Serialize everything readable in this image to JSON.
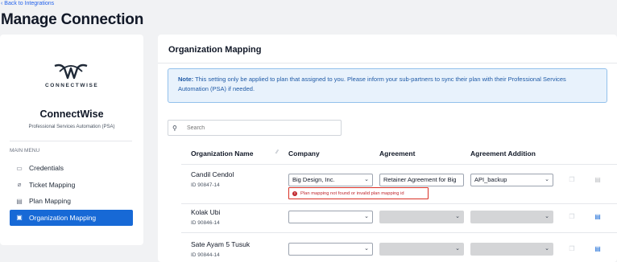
{
  "nav": {
    "back_label": "‹ Back to Integrations"
  },
  "page": {
    "title": "Manage Connection"
  },
  "integration": {
    "logo_text": "CONNECTWISE",
    "name": "ConnectWise",
    "subtitle": "Professional Services Automation (PSA)"
  },
  "menu": {
    "heading": "MAIN MENU",
    "items": [
      {
        "label": "Credentials",
        "icon": "credentials-icon",
        "glyph": "▭"
      },
      {
        "label": "Ticket Mapping",
        "icon": "paperclip-icon",
        "glyph": "⌀"
      },
      {
        "label": "Plan Mapping",
        "icon": "plan-icon",
        "glyph": "▤"
      },
      {
        "label": "Organization Mapping",
        "icon": "organization-icon",
        "glyph": "▣",
        "active": true
      }
    ]
  },
  "panel": {
    "title": "Organization Mapping",
    "note_label": "Note:",
    "note_text": " This setting only be applied to plan that assigned to you. Please inform your sub-partners to sync their plan with their Professional Services Automation (PSA) if needed."
  },
  "search": {
    "placeholder": "Search",
    "value": ""
  },
  "table": {
    "headers": {
      "org": "Organization Name",
      "company": "Company",
      "agreement": "Agreement",
      "addition": "Agreement Addition"
    },
    "rows": [
      {
        "name": "Candil Cendol",
        "id": "ID 90847-14",
        "company": "Big Design, Inc.",
        "agreement": "Retainer Agreement for Big",
        "addition": "API_backup",
        "error": "Plan mapping not found or invalid plan mapping id",
        "save_enabled": false
      },
      {
        "name": "Kolak Ubi",
        "id": "ID 90846-14",
        "company": "",
        "agreement": "",
        "addition": "",
        "save_enabled": true
      },
      {
        "name": "Sate Ayam 5 Tusuk",
        "id": "ID 90844-14",
        "company": "",
        "agreement": "",
        "addition": "",
        "save_enabled": true
      }
    ]
  },
  "colors": {
    "accent": "#1769d6",
    "error": "#d93025",
    "note_bg": "#e8f2fc"
  }
}
